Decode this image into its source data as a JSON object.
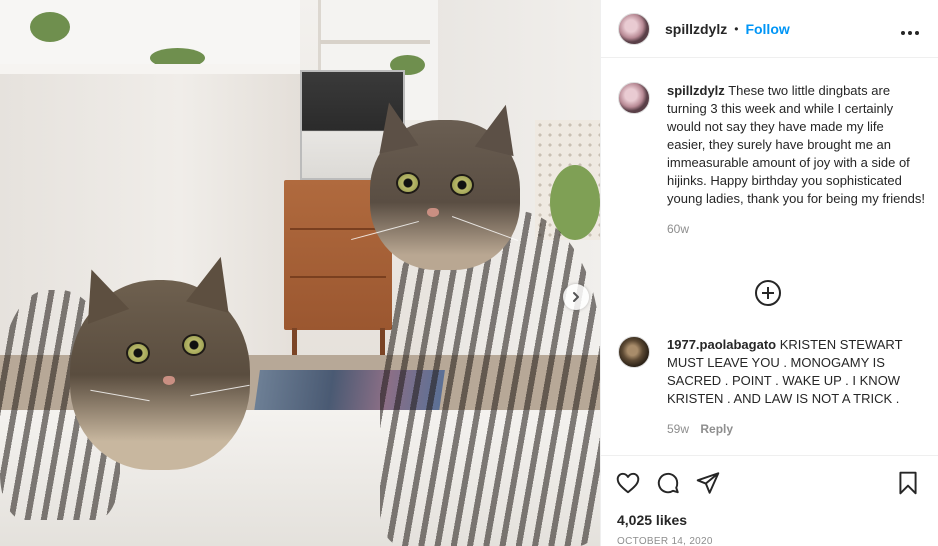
{
  "post": {
    "author": "spillzdylz",
    "separator": "•",
    "follow_label": "Follow",
    "more_label": "•••",
    "caption": "These two little dingbats are turning 3 this week and while I certainly would not say they have made my life easier, they surely have brought me an immeasurable amount of joy with a side of hijinks. Happy birthday you sophisticated young ladies, thank you for being my friends!",
    "caption_age": "60w",
    "likes": "4,025 likes",
    "date": "OCTOBER 14, 2020"
  },
  "comments": [
    {
      "username": "1977.paolabagato",
      "text": "KRISTEN STEWART MUST LEAVE YOU . MONOGAMY IS SACRED . POINT . WAKE UP . I KNOW KRISTEN . AND LAW IS NOT A TRICK .",
      "age": "59w",
      "reply_label": "Reply"
    }
  ],
  "icons": {
    "like": "heart-icon",
    "comment": "comment-bubble-icon",
    "share": "paper-plane-icon",
    "save": "bookmark-icon",
    "next": "chevron-right-icon",
    "load_more": "plus-circle-icon"
  },
  "colors": {
    "link": "#0095f6",
    "text": "#262626",
    "muted": "#8e8e8e",
    "border": "#efefef"
  }
}
